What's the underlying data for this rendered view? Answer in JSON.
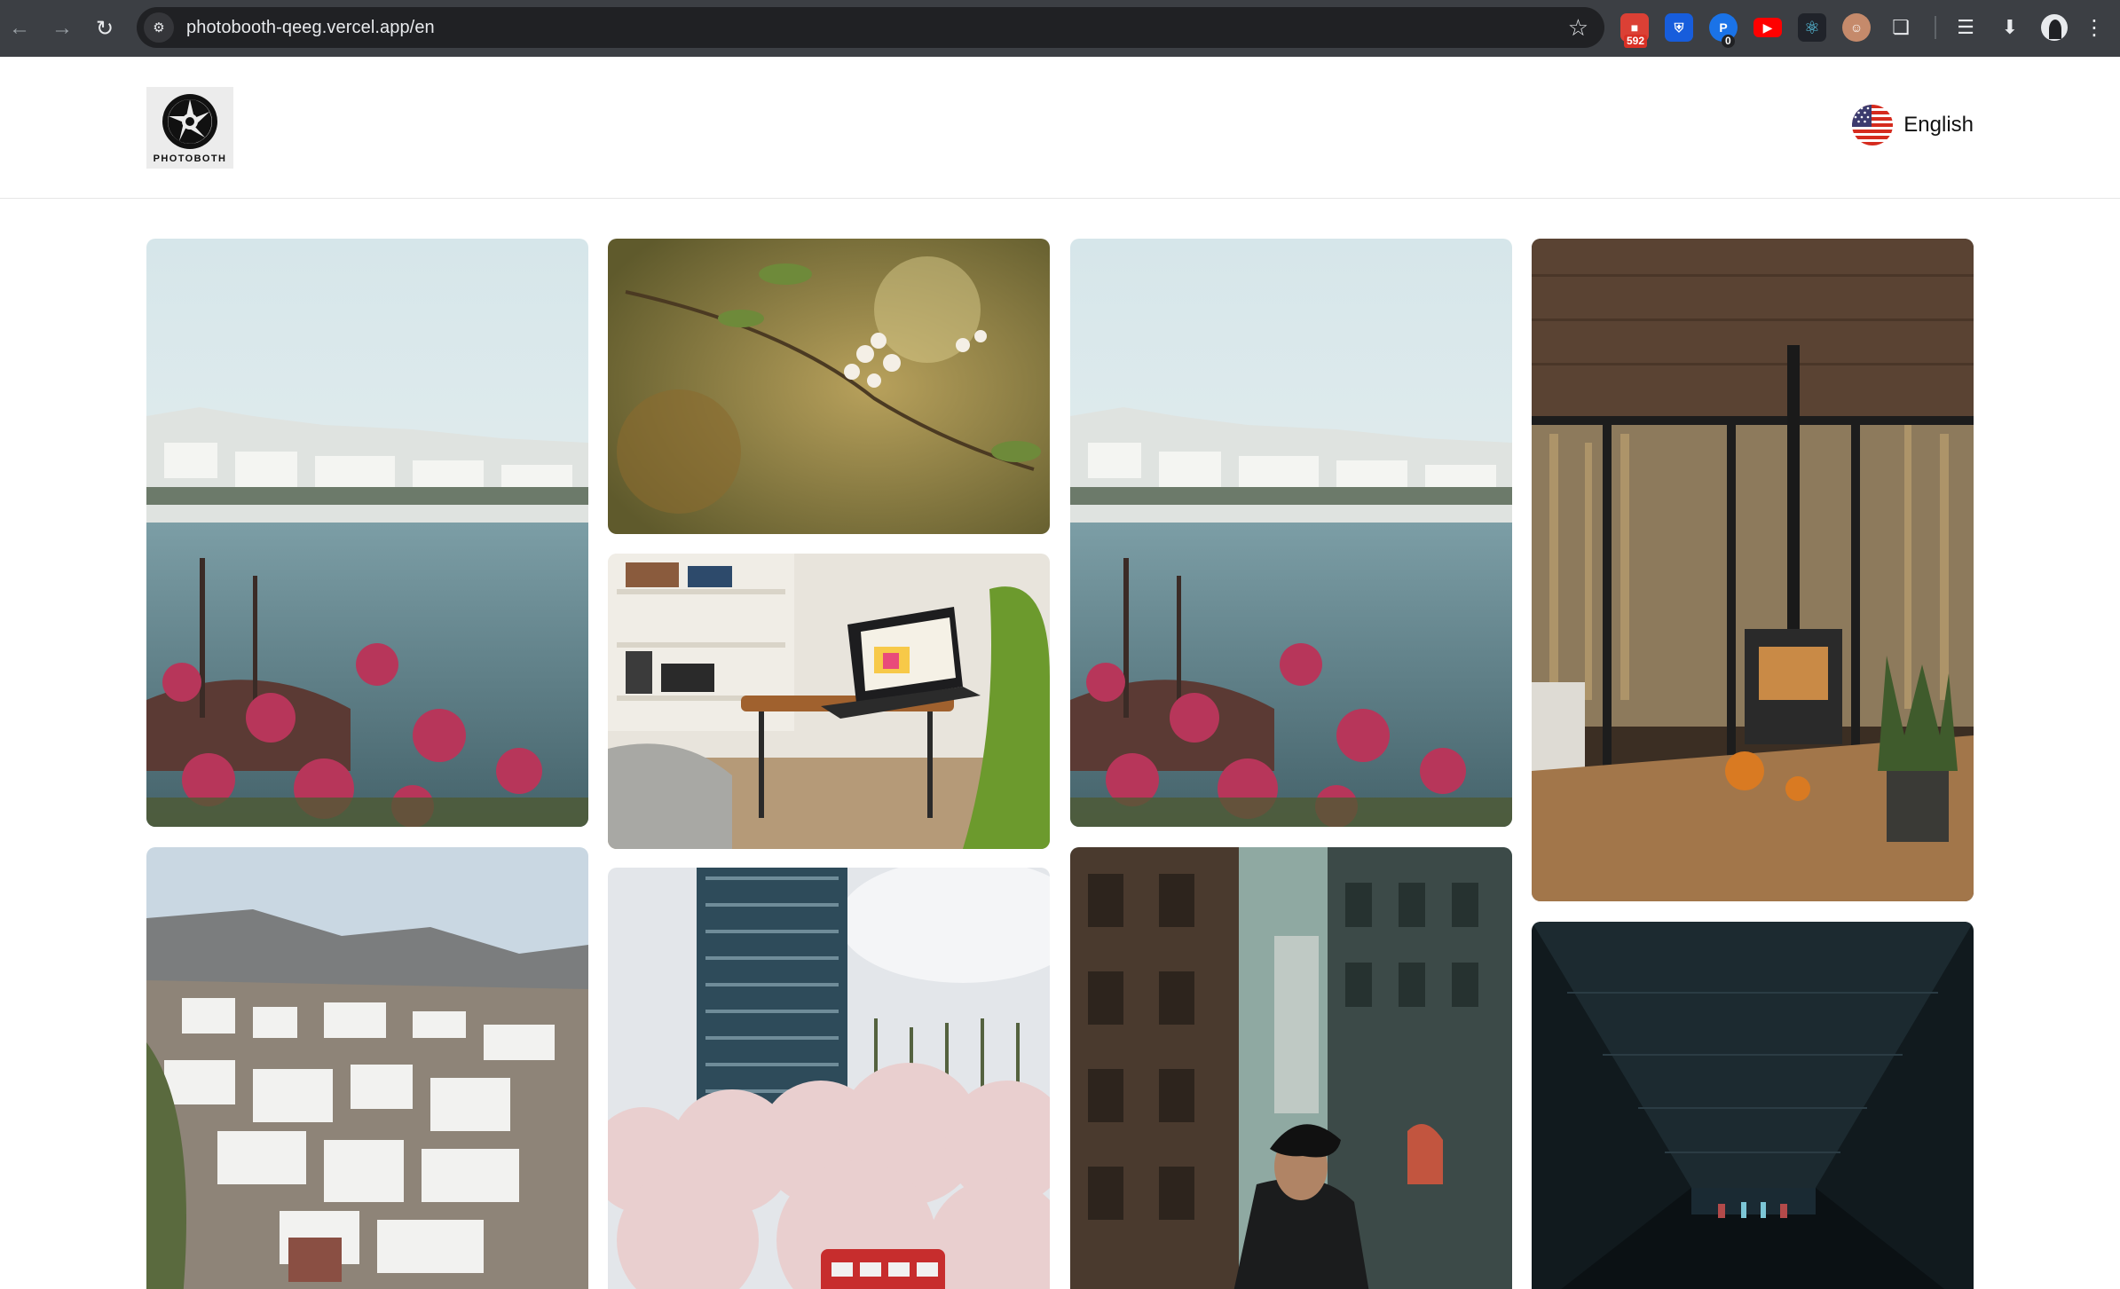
{
  "browser": {
    "url": "photobooth-qeeg.vercel.app/en",
    "back_icon": "arrow-left-icon",
    "forward_icon": "arrow-right-icon",
    "reload_icon": "reload-icon",
    "bookmark_icon": "star-icon",
    "extensions": [
      {
        "name": "todoist-extension-icon",
        "badge": "592",
        "color": "#db4035"
      },
      {
        "name": "bitwarden-extension-icon",
        "badge": "",
        "color": "#175ddc"
      },
      {
        "name": "extension-icon-blue",
        "badge": "0",
        "color": "#1a73e8"
      },
      {
        "name": "youtube-extension-icon",
        "badge": "",
        "color": "#ff0000"
      },
      {
        "name": "react-devtools-extension-icon",
        "badge": "",
        "color": "#61dafb"
      },
      {
        "name": "avatar-extension-icon",
        "badge": "",
        "color": "#c58a6b"
      },
      {
        "name": "puzzle-extensions-icon",
        "badge": "",
        "color": "#e8eaed"
      }
    ]
  },
  "header": {
    "logo_text": "PHOTOBOTH",
    "language_label": "English",
    "language_flag": "us-flag-icon"
  },
  "gallery": {
    "photos": [
      {
        "name": "photo-mykonos-harbor-1",
        "subject": "coastal town with boat and pink flowers"
      },
      {
        "name": "photo-blossom-branch",
        "subject": "white blossom branch"
      },
      {
        "name": "photo-laptop-desk",
        "subject": "laptop on side table in living room"
      },
      {
        "name": "photo-mykonos-harbor-2",
        "subject": "coastal town with boat and pink flowers"
      },
      {
        "name": "photo-cabin-interior",
        "subject": "cabin interior with wood stove"
      },
      {
        "name": "photo-santorini",
        "subject": "white village on hillside"
      },
      {
        "name": "photo-tower-cherry",
        "subject": "glass tower with cherry blossoms and red bus"
      },
      {
        "name": "photo-city-man",
        "subject": "man in turban in city alley"
      },
      {
        "name": "photo-dark-corridor",
        "subject": "dark corridor"
      }
    ]
  }
}
